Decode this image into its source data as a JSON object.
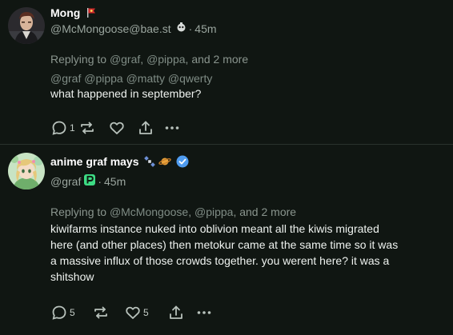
{
  "posts": [
    {
      "display_name": "Mong",
      "handle": "@McMongoose@bae.st",
      "separator": "·",
      "time": "45m",
      "replying_prefix": "Replying to",
      "replying_mentions": [
        "@graf",
        "@pippa"
      ],
      "replying_more": "and 2 more",
      "mentions_text": "@graf @pippa @matty @qwerty",
      "body_lines": [
        "what happened in september?"
      ],
      "actions": {
        "reply_count": "1",
        "boost_count": "",
        "fav_count": ""
      },
      "icons": [
        "flag-icon",
        "bot-icon",
        "reply-icon",
        "boost-icon",
        "favourite-icon",
        "share-icon",
        "more-icon"
      ]
    },
    {
      "display_name": "anime graf mays",
      "handle": "@graf",
      "separator": "·",
      "time": "45m",
      "replying_prefix": "Replying to",
      "replying_mentions": [
        "@McMongoose",
        "@pippa"
      ],
      "replying_more": "and 2 more",
      "body_lines": [
        "kiwifarms instance nuked into oblivion meant all the kiwis migrated",
        "here (and other places) then metokur came at the same time so it was",
        "a massive influx of those crowds together. you werent here? it was a",
        "shitshow"
      ],
      "actions": {
        "reply_count": "5",
        "boost_count": "",
        "fav_count": "5"
      },
      "icons": [
        "satellite-emoji-icon",
        "planet-emoji-icon",
        "verified-icon",
        "p-badge-icon",
        "reply-icon",
        "boost-icon",
        "favourite-icon",
        "share-icon",
        "more-icon"
      ]
    }
  ],
  "colors": {
    "background": "#101612",
    "text": "#eef2ef",
    "muted": "#9aa59e",
    "verified": "#4f9cf0",
    "badge_green": "#3ddc84",
    "flag_red": "#d22b2b"
  }
}
